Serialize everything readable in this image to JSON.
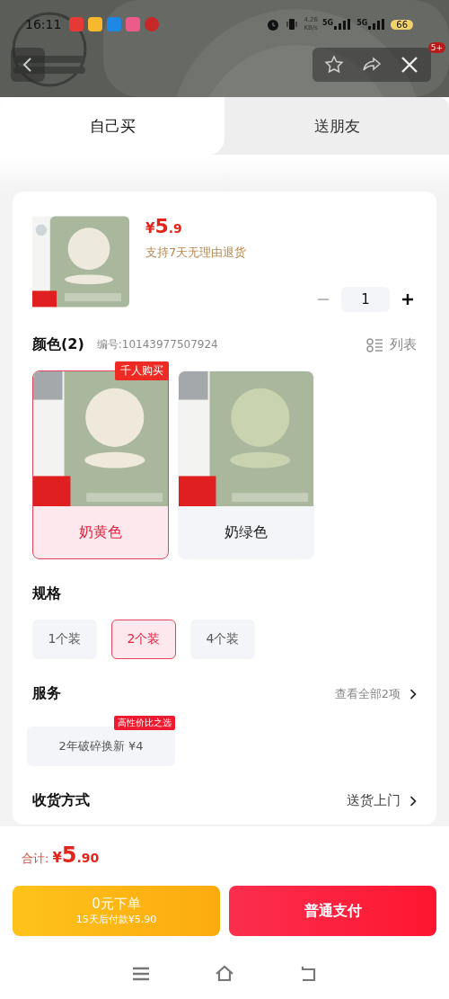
{
  "status_bar": {
    "time": "16:11",
    "speed": "4.26",
    "speed_unit": "KB/s",
    "networks": [
      "5G",
      "5G"
    ],
    "battery": "66"
  },
  "top_bar": {
    "badge": "5+"
  },
  "tabs": [
    {
      "label": "自己买",
      "selected": true
    },
    {
      "label": "送朋友",
      "selected": false
    }
  ],
  "product": {
    "currency": "¥",
    "price_main": "5",
    "price_fraction": ".9",
    "return_policy": "支持7天无理由退货",
    "quantity": "1"
  },
  "colors": {
    "title": "颜色(2)",
    "code": "编号:10143977507924",
    "list_label": "列表",
    "options": [
      {
        "label": "奶黄色",
        "selected": true,
        "tag": "千人购买"
      },
      {
        "label": "奶绿色",
        "selected": false
      }
    ]
  },
  "spec": {
    "title": "规格",
    "options": [
      {
        "label": "1个装",
        "selected": false
      },
      {
        "label": "2个装",
        "selected": true
      },
      {
        "label": "4个装",
        "selected": false
      }
    ]
  },
  "service": {
    "title": "服务",
    "link": "查看全部2项",
    "items": [
      {
        "label": "2年破碎换新 ¥4",
        "tag": "高性价比之选"
      }
    ]
  },
  "delivery": {
    "title": "收货方式",
    "value": "送货上门"
  },
  "footer": {
    "total_label": "合计:",
    "currency": "¥",
    "price_main": "5",
    "price_fraction": ".90",
    "deferred_button": {
      "title": "0元下单",
      "subtitle": "15天后付款¥5.90"
    },
    "pay_button": "普通支付"
  }
}
